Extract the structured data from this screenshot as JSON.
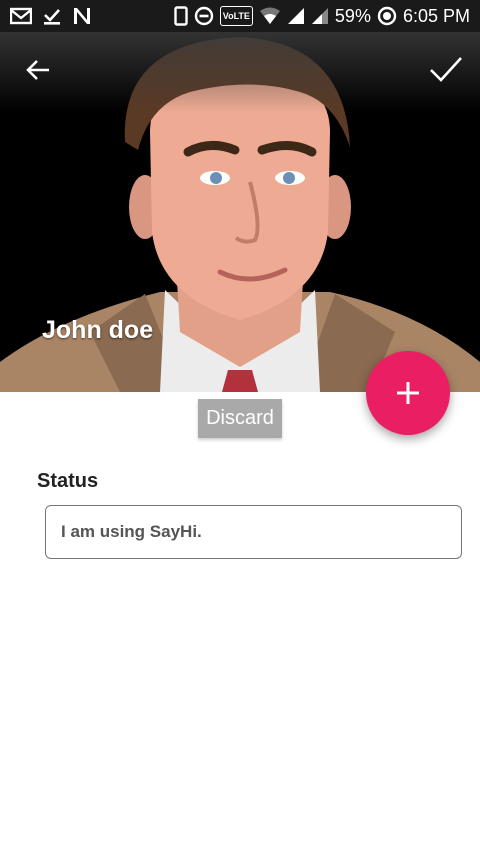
{
  "status_bar": {
    "battery": "59%",
    "time": "6:05 PM",
    "volte": "VoLTE",
    "icons": [
      "gmail-icon",
      "download-done-icon",
      "n-app-icon",
      "phone-outline-icon",
      "dnd-icon",
      "volte-icon",
      "wifi-icon",
      "signal-icon",
      "signal-icon",
      "battery-saver-icon"
    ]
  },
  "toolbar": {
    "back_icon": "arrow-back-icon",
    "confirm_icon": "check-icon"
  },
  "profile": {
    "name": "John doe"
  },
  "fab": {
    "icon": "plus-icon",
    "color": "#e91e63"
  },
  "discard_label": "Discard",
  "status": {
    "label": "Status",
    "value": "I am using SayHi."
  }
}
